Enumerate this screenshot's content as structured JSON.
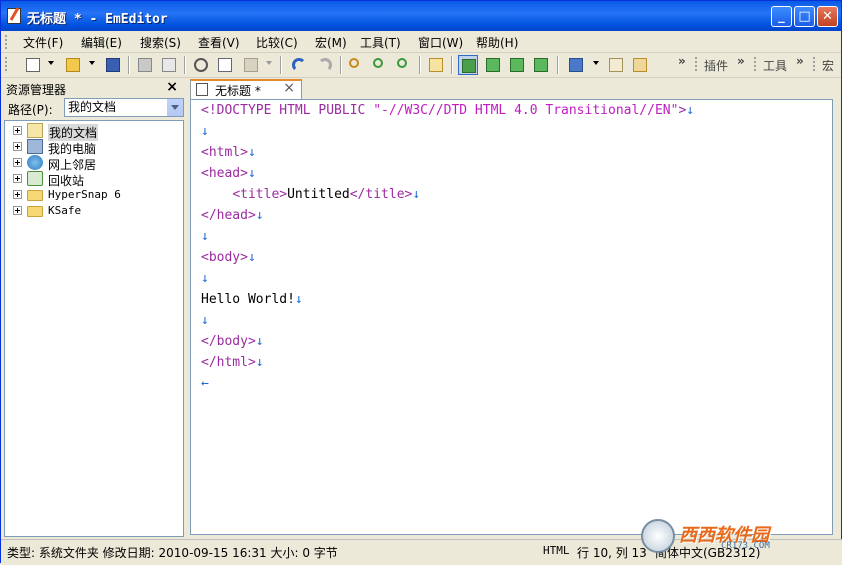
{
  "window": {
    "title": "无标题 * - EmEditor"
  },
  "menu": [
    "文件(F)",
    "编辑(E)",
    "搜索(S)",
    "查看(V)",
    "比较(C)",
    "宏(M)",
    "工具(T)",
    "窗口(W)",
    "帮助(H)"
  ],
  "toolbar": {
    "chevron": "»",
    "plugins_label": "插件",
    "tools_label": "工具",
    "macro_label": "宏"
  },
  "sidebar": {
    "title": "资源管理器",
    "close": "×",
    "path_label": "路径(P):",
    "path_value": "我的文档",
    "tree": [
      {
        "label": "我的文档",
        "icon": "my-documents-icon"
      },
      {
        "label": "我的电脑",
        "icon": "my-computer-icon"
      },
      {
        "label": "网上邻居",
        "icon": "network-places-icon"
      },
      {
        "label": "回收站",
        "icon": "recycle-bin-icon"
      },
      {
        "label": "HyperSnap 6",
        "icon": "folder-icon"
      },
      {
        "label": "KSafe",
        "icon": "folder-icon"
      }
    ]
  },
  "editor": {
    "tab_label": "无标题 *",
    "tab_close": "×",
    "newline_mark": "↓",
    "eof_mark": "←",
    "lines": {
      "l1_tag": "<!DOCTYPE HTML PUBLIC ",
      "l1_str": "\"-//W3C//DTD HTML 4.0 Transitional//EN\"",
      "l1_end": ">",
      "l3": "<html>",
      "l4": "<head>",
      "l5_indent": "    ",
      "l5_open": "<title>",
      "l5_text": "Untitled",
      "l5_close": "</title>",
      "l6": "</head>",
      "l8": "<body>",
      "l10": "Hello World!",
      "l12": "</body>",
      "l13": "</html>"
    }
  },
  "status": {
    "left": "类型: 系统文件夹 修改日期: 2010-09-15 16:31 大小: 0 字节",
    "mode": "HTML",
    "position": "行 10, 列 13",
    "encoding": "简体中文(GB2312)"
  },
  "watermark": {
    "text": "西西软件园",
    "sub": "CR173.COM"
  },
  "colors": {
    "title_bar": "#0a5ae8",
    "tag": "#9b2ba1",
    "string": "#c01dc2",
    "newline": "#1e6bd6",
    "tab_accent": "#e68b2c"
  }
}
